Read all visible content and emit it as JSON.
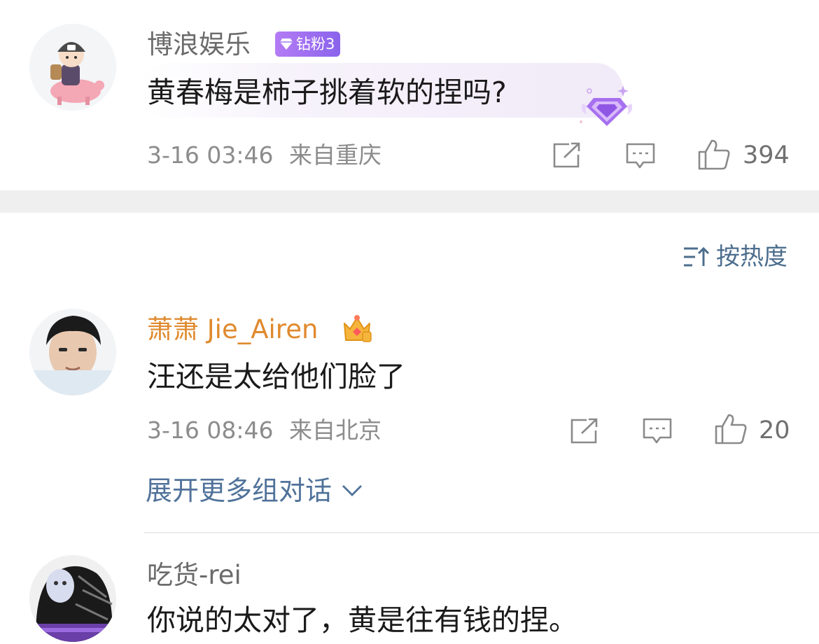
{
  "top_comment": {
    "username": "博浪娱乐",
    "badge": "钻粉3",
    "text": "黄春梅是柿子挑着软的捏吗?",
    "time": "3-16 03:46",
    "location": "来自重庆",
    "likes": "394",
    "avatar_icon": "avatar-cartoon-boy-on-pig",
    "icons": [
      "share-icon",
      "comment-icon",
      "like-icon"
    ]
  },
  "sort": {
    "label": "按热度",
    "icon": "sort-icon"
  },
  "comments": [
    {
      "username": "萧萧 Jie_Airen",
      "name_color": "#e08a2e",
      "vip_icon": "crown-vip-icon",
      "text": "汪还是太给他们脸了",
      "time": "3-16 08:46",
      "location": "来自北京",
      "likes": "20",
      "avatar_icon": "avatar-photo"
    },
    {
      "username": "吃货-rei",
      "text": "你说的太对了，黄是往有钱的捏。",
      "avatar_icon": "avatar-dark-art"
    }
  ],
  "expand": {
    "label": "展开更多组对话"
  },
  "colors": {
    "link": "#50729a",
    "meta": "#8c8c8c",
    "badge": "#9b6cf0"
  }
}
